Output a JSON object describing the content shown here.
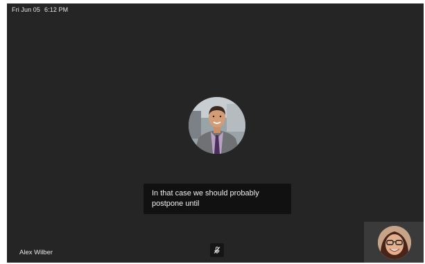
{
  "status_bar": {
    "date": "Fri Jun 05",
    "time": "6:12 PM"
  },
  "main_participant": {
    "avatar_icon": "person-photo-avatar"
  },
  "caption": {
    "text": "In that case we should probably postpone until"
  },
  "participant_label": {
    "name": "Alex Wilber"
  },
  "controls": {
    "mute_icon": "microphone-muted-icon"
  },
  "self_view": {
    "avatar_icon": "self-photo-avatar"
  },
  "colors": {
    "stage_background": "#252525",
    "caption_background": "#111111",
    "text": "#e6e6e6"
  }
}
